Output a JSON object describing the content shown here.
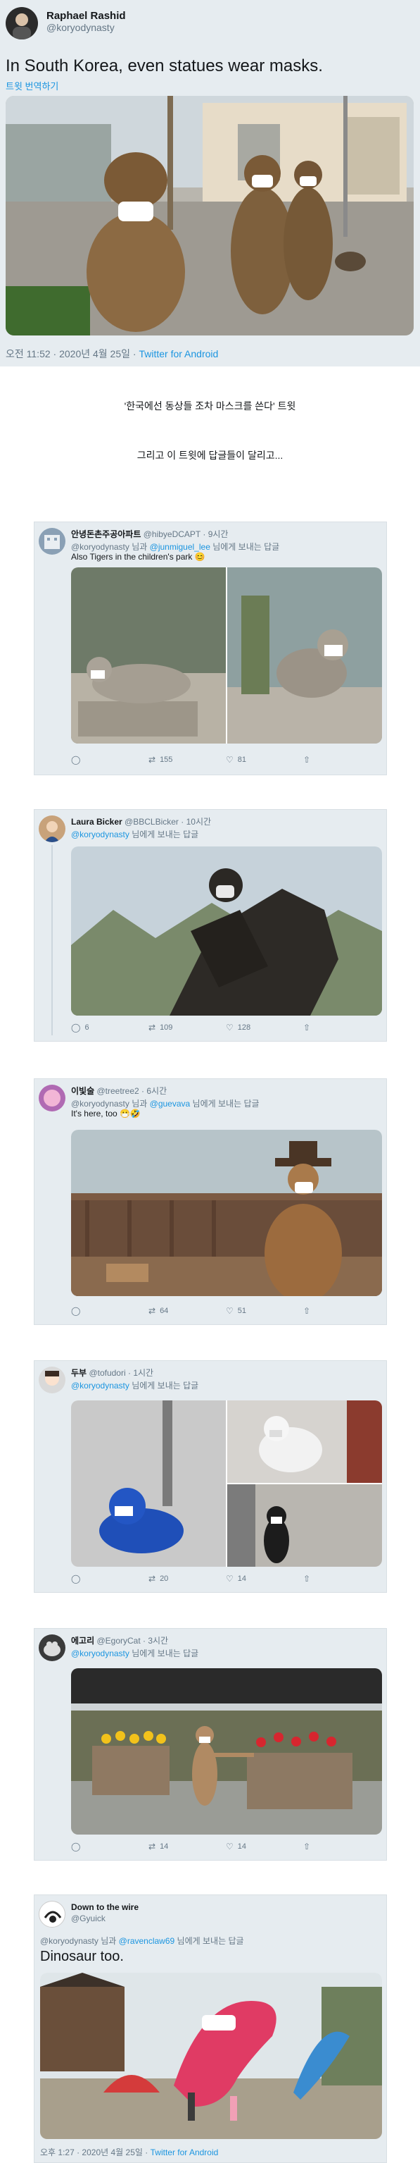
{
  "main_tweet": {
    "author_name": "Raphael Rashid",
    "author_handle": "@koryodynasty",
    "text": "In South Korea, even statues wear masks.",
    "translate_label": "트윗 번역하기",
    "time": "오전 11:52 · 2020년 4월 25일",
    "client": "Twitter for Android"
  },
  "captions": {
    "line1": "'한국에선 동상들 조차 마스크를 쓴다' 트윗",
    "line2": "그리고 이 트윗에 답글들이 달리고..."
  },
  "replies": [
    {
      "name": "안녕돈촌주공아파트",
      "handle": "@hibyeDCAPT",
      "time": "· 9시간",
      "reply_prefix": "@koryodynasty 님과 ",
      "reply_mention": "@junmiguel_lee",
      "reply_suffix": " 님에게 보내는 답글",
      "text": "Also Tigers in the children's park 😊",
      "counts": {
        "reply": "",
        "retweet": "155",
        "like": "81"
      }
    },
    {
      "name": "Laura Bicker",
      "handle": "@BBCLBicker",
      "time": "· 10시간",
      "reply_prefix": "",
      "reply_mention": "@koryodynasty",
      "reply_suffix": " 님에게 보내는 답글",
      "text": "",
      "counts": {
        "reply": "6",
        "retweet": "109",
        "like": "128"
      }
    },
    {
      "name": "이빛술",
      "handle": "@treetree2",
      "time": "· 6시간",
      "reply_prefix": "@koryodynasty 님과 ",
      "reply_mention": "@guevava",
      "reply_suffix": " 님에게 보내는 답글",
      "text": "It's here, too 😷🤣",
      "counts": {
        "reply": "",
        "retweet": "64",
        "like": "51"
      }
    },
    {
      "name": "두부",
      "handle": "@tofudori",
      "time": "· 1시간",
      "reply_prefix": "",
      "reply_mention": "@koryodynasty",
      "reply_suffix": " 님에게 보내는 답글",
      "text": "",
      "counts": {
        "reply": "",
        "retweet": "20",
        "like": "14"
      }
    },
    {
      "name": "에고리",
      "handle": "@EgoryCat",
      "time": "· 3시간",
      "reply_prefix": "",
      "reply_mention": "@koryodynasty",
      "reply_suffix": " 님에게 보내는 답글",
      "text": "",
      "counts": {
        "reply": "",
        "retweet": "14",
        "like": "14"
      }
    },
    {
      "name": "Down to the wire",
      "handle": "@Gyuick",
      "time": "",
      "reply_prefix": "@koryodynasty 님과 ",
      "reply_mention": "@ravenclaw69",
      "reply_suffix": " 님에게 보내는 답글",
      "text": "Dinosaur too.",
      "footer_time": "오후 1:27 · 2020년 4월 25일 · ",
      "footer_client": "Twitter for Android"
    }
  ]
}
